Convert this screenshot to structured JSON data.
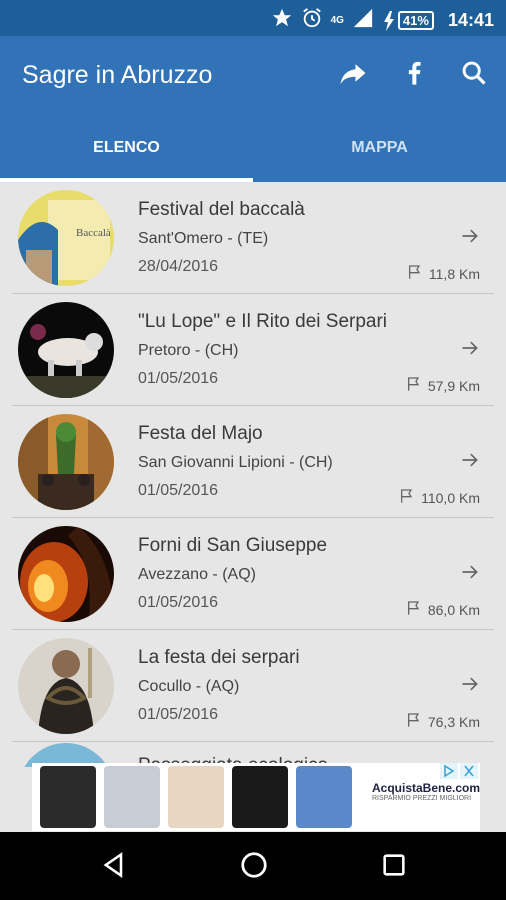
{
  "statusbar": {
    "time": "14:41",
    "battery": "41%",
    "network": "4G"
  },
  "appbar": {
    "title": "Sagre in Abruzzo",
    "icons": [
      "share-icon",
      "facebook-icon",
      "search-icon"
    ]
  },
  "tabs": [
    {
      "label": "ELENCO",
      "active": true
    },
    {
      "label": "MAPPA",
      "active": false
    }
  ],
  "events": [
    {
      "title": "Festival del baccalà",
      "place": "Sant'Omero - (TE)",
      "date": "28/04/2016",
      "distance": "11,8 Km"
    },
    {
      "title": "\"Lu Lope\" e Il Rito dei Serpari",
      "place": "Pretoro - (CH)",
      "date": "01/05/2016",
      "distance": "57,9 Km"
    },
    {
      "title": "Festa del Majo",
      "place": "San Giovanni Lipioni - (CH)",
      "date": "01/05/2016",
      "distance": "110,0 Km"
    },
    {
      "title": "Forni di San Giuseppe",
      "place": "Avezzano - (AQ)",
      "date": "01/05/2016",
      "distance": "86,0 Km"
    },
    {
      "title": "La festa dei serpari",
      "place": "Cocullo - (AQ)",
      "date": "01/05/2016",
      "distance": "76,3 Km"
    }
  ],
  "partial_title": "Passeggiata ecologica",
  "ad": {
    "brand": "AcquistaBene.com",
    "tagline": "RISPARMIO PREZZI MIGLIORI"
  },
  "colors": {
    "statusbar": "#1f5f99",
    "appbar": "#3272b6",
    "background": "#e6e6e6"
  }
}
